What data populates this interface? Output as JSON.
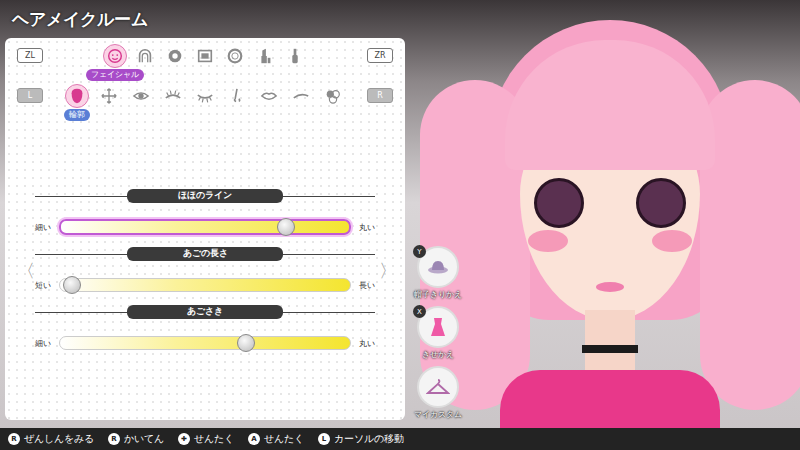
{
  "window": {
    "title": "ヘアメイクルーム"
  },
  "category_tabs": {
    "prev_key": "ZL",
    "next_key": "ZR",
    "items": [
      {
        "selected": true,
        "label": "フェイシャル"
      },
      {
        "selected": false
      },
      {
        "selected": false
      },
      {
        "selected": false
      },
      {
        "selected": false
      },
      {
        "selected": false
      },
      {
        "selected": false
      }
    ]
  },
  "part_tabs": {
    "prev_key": "L",
    "next_key": "R",
    "items": [
      {
        "selected": true,
        "label": "輪郭"
      },
      {
        "selected": false
      },
      {
        "selected": false
      },
      {
        "selected": false
      },
      {
        "selected": false
      },
      {
        "selected": false
      },
      {
        "selected": false
      },
      {
        "selected": false
      },
      {
        "selected": false
      }
    ]
  },
  "page_nav": {
    "prev": "〈",
    "next": "〉"
  },
  "sliders": [
    {
      "label": "ほほのライン",
      "min_label": "細い",
      "max_label": "丸い",
      "level": 0.78,
      "selected": true
    },
    {
      "label": "あごの長さ",
      "min_label": "短い",
      "max_label": "長い",
      "level": 0.04,
      "selected": false
    },
    {
      "label": "あごさき",
      "min_label": "細い",
      "max_label": "丸い",
      "level": 0.64,
      "selected": false
    }
  ],
  "side_buttons": [
    {
      "key": "Y",
      "label": "帽子きりかえ"
    },
    {
      "key": "X",
      "label": "きせかえ"
    },
    {
      "key": "",
      "label": "マイカスタム"
    }
  ],
  "hints": [
    {
      "key": "R",
      "label": "ぜんしんをみる"
    },
    {
      "key": "R",
      "label": "かいてん"
    },
    {
      "key": "✚",
      "label": "せんたく"
    },
    {
      "key": "A",
      "label": "せんたく"
    },
    {
      "key": "L",
      "label": "カーソルの移動"
    }
  ]
}
